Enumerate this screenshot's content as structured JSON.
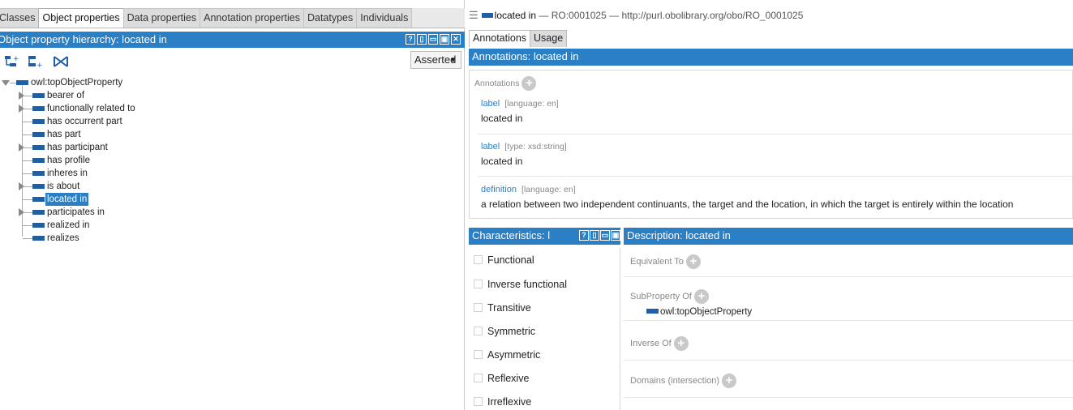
{
  "tabs": [
    "Classes",
    "Object properties",
    "Data properties",
    "Annotation properties",
    "Datatypes",
    "Individuals"
  ],
  "active_tab": "Object properties",
  "hierarchy": {
    "title": "Object property hierarchy: located in",
    "view_mode": "Asserted",
    "window_buttons": [
      "?",
      "▯",
      "▭",
      "▣",
      "✕"
    ],
    "root": "owl:topObjectProperty",
    "items": [
      {
        "label": "bearer of",
        "expandable": true
      },
      {
        "label": "functionally related to",
        "expandable": true
      },
      {
        "label": "has occurrent part",
        "expandable": false
      },
      {
        "label": "has part",
        "expandable": false
      },
      {
        "label": "has participant",
        "expandable": true
      },
      {
        "label": "has profile",
        "expandable": false
      },
      {
        "label": "inheres in",
        "expandable": false
      },
      {
        "label": "is about",
        "expandable": true
      },
      {
        "label": "located in",
        "expandable": false,
        "selected": true
      },
      {
        "label": "participates in",
        "expandable": true
      },
      {
        "label": "realized in",
        "expandable": false
      },
      {
        "label": "realizes",
        "expandable": false
      }
    ]
  },
  "entity": {
    "name": "located in",
    "id": "RO:0001025",
    "iri": "http://purl.obolibrary.org/obo/RO_0001025",
    "separator": "—"
  },
  "right_tabs": [
    "Annotations",
    "Usage"
  ],
  "annotations": {
    "header": "Annotations: located in",
    "section_label": "Annotations",
    "rows": [
      {
        "key": "label",
        "meta": "[language: en]",
        "value": "located in"
      },
      {
        "key": "label",
        "meta": "[type: xsd:string]",
        "value": "located in"
      },
      {
        "key": "definition",
        "meta": "[language: en]",
        "value": "a relation between two independent continuants, the target and the location, in which the target is entirely within the location"
      }
    ]
  },
  "characteristics": {
    "header": "Characteristics: l",
    "items": [
      "Functional",
      "Inverse functional",
      "Transitive",
      "Symmetric",
      "Asymmetric",
      "Reflexive",
      "Irreflexive"
    ]
  },
  "description": {
    "header": "Description: located in",
    "sections": {
      "equivalent_to": "Equivalent To",
      "subproperty_of": "SubProperty Of",
      "inverse_of": "Inverse Of",
      "domains": "Domains (intersection)"
    },
    "subproperty_value": "owl:topObjectProperty"
  },
  "colors": {
    "header_blue": "#2b7fc4",
    "property_bar": "#1f5fa8",
    "link_blue": "#2b7fc4"
  }
}
